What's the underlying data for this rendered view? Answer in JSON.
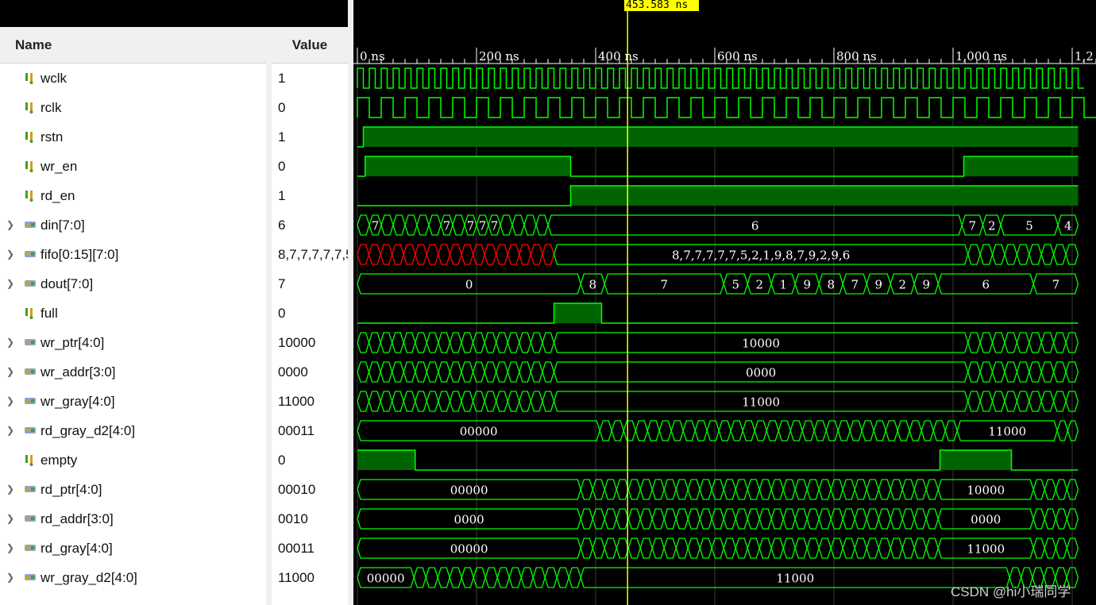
{
  "headers": {
    "name": "Name",
    "value": "Value"
  },
  "cursor": {
    "time_label": "453.583 ns",
    "time_ns": 453.583
  },
  "timeline": {
    "ticks": [
      {
        "t": 0,
        "label": "0 ns"
      },
      {
        "t": 200,
        "label": "200 ns"
      },
      {
        "t": 400,
        "label": "400 ns"
      },
      {
        "t": 600,
        "label": "600 ns"
      },
      {
        "t": 800,
        "label": "800 ns"
      },
      {
        "t": 1000,
        "label": "1,000 ns"
      },
      {
        "t": 1200,
        "label": "1,2"
      }
    ]
  },
  "colors": {
    "wave": "#00ff00",
    "fill": "#006400",
    "invalid": "#ff0000",
    "grid": "#3a3a3a",
    "cursor": "#ffff00",
    "tick_text": "#ffffff"
  },
  "icons": {
    "bit": "logic-bit-icon",
    "bus": "logic-bus-icon",
    "expand": "chevron-right-icon"
  },
  "signals": [
    {
      "name": "wclk",
      "value": "1",
      "kind": "bit",
      "expandable": false
    },
    {
      "name": "rclk",
      "value": "0",
      "kind": "bit",
      "expandable": false
    },
    {
      "name": "rstn",
      "value": "1",
      "kind": "bit",
      "expandable": false
    },
    {
      "name": "wr_en",
      "value": "0",
      "kind": "bit",
      "expandable": false
    },
    {
      "name": "rd_en",
      "value": "1",
      "kind": "bit",
      "expandable": false
    },
    {
      "name": "din[7:0]",
      "value": "6",
      "kind": "bus",
      "expandable": true
    },
    {
      "name": "fifo[0:15][7:0]",
      "value": "8,7,7,7,7,7,5,2,1,9,8,7,9,2,9,6",
      "kind": "bus",
      "expandable": true
    },
    {
      "name": "dout[7:0]",
      "value": "7",
      "kind": "bus",
      "expandable": true
    },
    {
      "name": "full",
      "value": "0",
      "kind": "bit",
      "expandable": false
    },
    {
      "name": "wr_ptr[4:0]",
      "value": "10000",
      "kind": "bus",
      "expandable": true
    },
    {
      "name": "wr_addr[3:0]",
      "value": "0000",
      "kind": "bus",
      "expandable": true
    },
    {
      "name": "wr_gray[4:0]",
      "value": "11000",
      "kind": "bus",
      "expandable": true
    },
    {
      "name": "rd_gray_d2[4:0]",
      "value": "00011",
      "kind": "bus",
      "expandable": true
    },
    {
      "name": "empty",
      "value": "0",
      "kind": "bit",
      "expandable": false
    },
    {
      "name": "rd_ptr[4:0]",
      "value": "00010",
      "kind": "bus",
      "expandable": true
    },
    {
      "name": "rd_addr[3:0]",
      "value": "0010",
      "kind": "bus",
      "expandable": true
    },
    {
      "name": "rd_gray[4:0]",
      "value": "00011",
      "kind": "bus",
      "expandable": true
    },
    {
      "name": "wr_gray_d2[4:0]",
      "value": "11000",
      "kind": "bus",
      "expandable": true
    }
  ],
  "waves": {
    "wclk": {
      "type": "clock",
      "period_ns": 20,
      "start_ns": 0
    },
    "rclk": {
      "type": "clock",
      "period_ns": 40,
      "start_ns": 0
    },
    "rstn": {
      "type": "bit",
      "initial": 0,
      "edges_ns": [
        10
      ]
    },
    "wr_en": {
      "type": "bit",
      "initial": 0,
      "edges_ns": [
        13,
        358,
        1018
      ]
    },
    "rd_en": {
      "type": "bit",
      "initial": 0,
      "edges_ns": [
        358
      ]
    },
    "full": {
      "type": "bit",
      "initial": 0,
      "edges_ns": [
        330,
        410
      ]
    },
    "empty": {
      "type": "bit",
      "initial": 1,
      "edges_ns": [
        97,
        978,
        1098
      ]
    },
    "din[7:0]": {
      "type": "bus",
      "segments": [
        {
          "start": 0,
          "end": 20,
          "label": ""
        },
        {
          "start": 20,
          "end": 40,
          "label": "7"
        },
        {
          "start": 40,
          "end": 140,
          "label": ""
        },
        {
          "start": 140,
          "end": 160,
          "label": "7"
        },
        {
          "start": 160,
          "end": 180,
          "label": ""
        },
        {
          "start": 180,
          "end": 200,
          "label": "7"
        },
        {
          "start": 200,
          "end": 220,
          "label": "7"
        },
        {
          "start": 220,
          "end": 240,
          "label": "7"
        },
        {
          "start": 240,
          "end": 320,
          "label": ""
        },
        {
          "start": 320,
          "end": 1015,
          "label": "6"
        },
        {
          "start": 1015,
          "end": 1050,
          "label": "7"
        },
        {
          "start": 1050,
          "end": 1080,
          "label": "2"
        },
        {
          "start": 1080,
          "end": 1176,
          "label": "5"
        },
        {
          "start": 1176,
          "end": 1210,
          "label": "4"
        }
      ]
    },
    "fifo[0:15][7:0]": {
      "type": "bus",
      "segments": [
        {
          "start": 0,
          "end": 330,
          "label": "",
          "invalid": true
        },
        {
          "start": 330,
          "end": 1025,
          "label": "8,7,7,7,7,7,5,2,1,9,8,7,9,2,9,6"
        },
        {
          "start": 1025,
          "end": 1210,
          "label": ""
        }
      ]
    },
    "dout[7:0]": {
      "type": "bus",
      "segments": [
        {
          "start": 0,
          "end": 375,
          "label": "0"
        },
        {
          "start": 375,
          "end": 415,
          "label": "8"
        },
        {
          "start": 415,
          "end": 615,
          "label": "7"
        },
        {
          "start": 615,
          "end": 655,
          "label": "5"
        },
        {
          "start": 655,
          "end": 695,
          "label": "2"
        },
        {
          "start": 695,
          "end": 735,
          "label": "1"
        },
        {
          "start": 735,
          "end": 775,
          "label": "9"
        },
        {
          "start": 775,
          "end": 815,
          "label": "8"
        },
        {
          "start": 815,
          "end": 855,
          "label": "7"
        },
        {
          "start": 855,
          "end": 895,
          "label": "9"
        },
        {
          "start": 895,
          "end": 935,
          "label": "2"
        },
        {
          "start": 935,
          "end": 975,
          "label": "9"
        },
        {
          "start": 975,
          "end": 1135,
          "label": "6"
        },
        {
          "start": 1135,
          "end": 1210,
          "label": "7"
        }
      ]
    },
    "wr_ptr[4:0]": {
      "type": "bus",
      "segments": [
        {
          "start": 0,
          "end": 330,
          "label": ""
        },
        {
          "start": 330,
          "end": 1025,
          "label": "10000"
        },
        {
          "start": 1025,
          "end": 1210,
          "label": ""
        }
      ]
    },
    "wr_addr[3:0]": {
      "type": "bus",
      "segments": [
        {
          "start": 0,
          "end": 330,
          "label": ""
        },
        {
          "start": 330,
          "end": 1025,
          "label": "0000"
        },
        {
          "start": 1025,
          "end": 1210,
          "label": ""
        }
      ]
    },
    "wr_gray[4:0]": {
      "type": "bus",
      "segments": [
        {
          "start": 0,
          "end": 330,
          "label": ""
        },
        {
          "start": 330,
          "end": 1025,
          "label": "11000"
        },
        {
          "start": 1025,
          "end": 1210,
          "label": ""
        }
      ]
    },
    "rd_gray_d2[4:0]": {
      "type": "bus",
      "segments": [
        {
          "start": 0,
          "end": 407,
          "label": "00000"
        },
        {
          "start": 407,
          "end": 1007,
          "label": ""
        },
        {
          "start": 1007,
          "end": 1175,
          "label": "11000"
        },
        {
          "start": 1175,
          "end": 1210,
          "label": ""
        }
      ]
    },
    "rd_ptr[4:0]": {
      "type": "bus",
      "segments": [
        {
          "start": 0,
          "end": 375,
          "label": "00000"
        },
        {
          "start": 375,
          "end": 975,
          "label": ""
        },
        {
          "start": 975,
          "end": 1135,
          "label": "10000"
        },
        {
          "start": 1135,
          "end": 1210,
          "label": ""
        }
      ]
    },
    "rd_addr[3:0]": {
      "type": "bus",
      "segments": [
        {
          "start": 0,
          "end": 375,
          "label": "0000"
        },
        {
          "start": 375,
          "end": 975,
          "label": ""
        },
        {
          "start": 975,
          "end": 1135,
          "label": "0000"
        },
        {
          "start": 1135,
          "end": 1210,
          "label": ""
        }
      ]
    },
    "rd_gray[4:0]": {
      "type": "bus",
      "segments": [
        {
          "start": 0,
          "end": 375,
          "label": "00000"
        },
        {
          "start": 375,
          "end": 975,
          "label": ""
        },
        {
          "start": 975,
          "end": 1135,
          "label": "11000"
        },
        {
          "start": 1135,
          "end": 1210,
          "label": ""
        }
      ]
    },
    "wr_gray_d2[4:0]": {
      "type": "bus",
      "segments": [
        {
          "start": 0,
          "end": 95,
          "label": "00000"
        },
        {
          "start": 95,
          "end": 375,
          "label": ""
        },
        {
          "start": 375,
          "end": 1095,
          "label": "11000"
        },
        {
          "start": 1095,
          "end": 1210,
          "label": ""
        }
      ]
    }
  },
  "watermark": "CSDN @hi小瑞同学"
}
